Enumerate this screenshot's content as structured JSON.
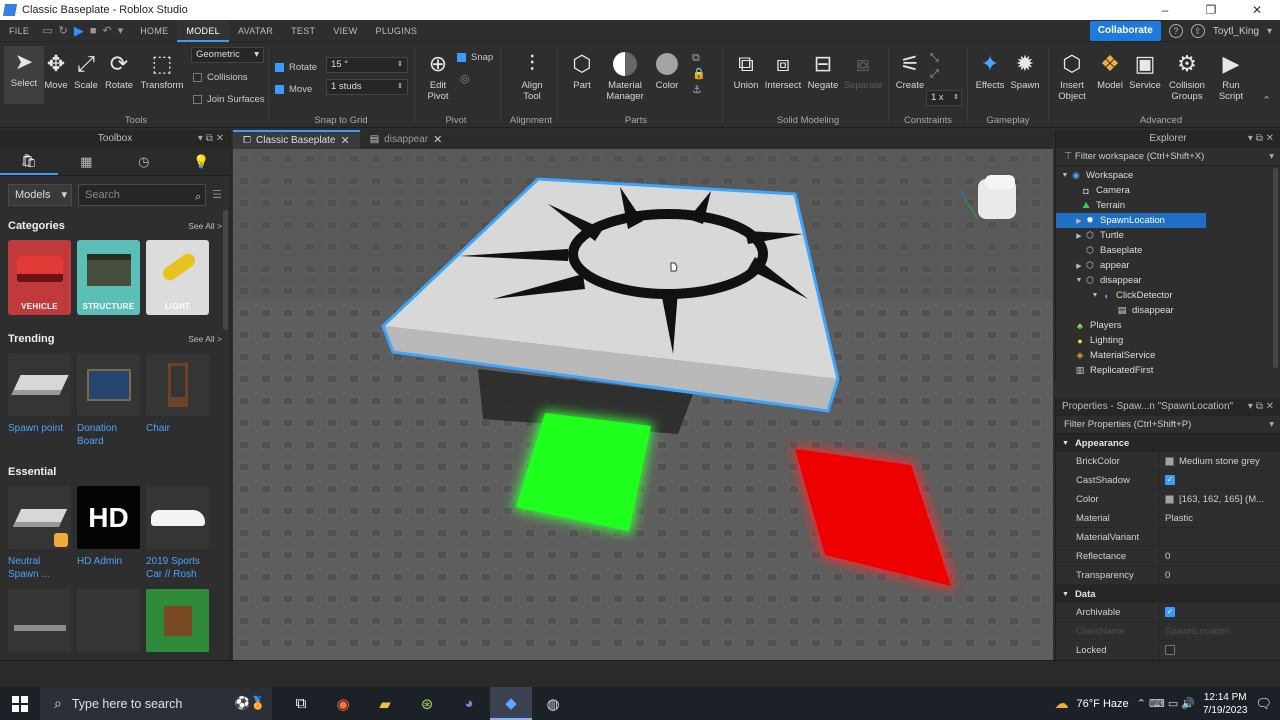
{
  "window": {
    "title": "Classic Baseplate - Roblox Studio"
  },
  "menu": {
    "file": "FILE",
    "tabs": [
      "HOME",
      "MODEL",
      "AVATAR",
      "TEST",
      "VIEW",
      "PLUGINS"
    ],
    "collaborate": "Collaborate",
    "user": "Toytl_King"
  },
  "ribbon": {
    "tools": {
      "select": "Select",
      "move": "Move",
      "scale": "Scale",
      "rotate": "Rotate",
      "transform": "Transform",
      "label": "Tools"
    },
    "mode_select": "Geometric",
    "collisions": "Collisions",
    "join_surfaces": "Join Surfaces",
    "snap": {
      "rotate_label": "Rotate",
      "rotate_value": "15 °",
      "move_label": "Move",
      "move_value": "1 studs",
      "label": "Snap to Grid"
    },
    "pivot": {
      "edit": "Edit Pivot",
      "snap": "Snap",
      "label": "Pivot"
    },
    "alignment": {
      "align": "Align Tool",
      "label": "Alignment"
    },
    "parts": {
      "part": "Part",
      "material": "Material Manager",
      "color": "Color",
      "label": "Parts"
    },
    "solid": {
      "union": "Union",
      "intersect": "Intersect",
      "negate": "Negate",
      "separate": "Separate",
      "label": "Solid Modeling"
    },
    "constraints": {
      "create": "Create",
      "scale": "1 x",
      "label": "Constraints"
    },
    "gameplay": {
      "effects": "Effects",
      "spawn": "Spawn",
      "label": "Gameplay"
    },
    "advanced": {
      "insert": "Insert Object",
      "model": "Model",
      "service": "Service",
      "collision": "Collision Groups",
      "run": "Run Script",
      "label": "Advanced"
    }
  },
  "toolbox": {
    "title": "Toolbox",
    "category_select": "Models",
    "search_placeholder": "Search",
    "categories_title": "Categories",
    "see_all": "See All >",
    "categories": [
      "VEHICLE",
      "STRUCTURE",
      "LIGHT"
    ],
    "trending_title": "Trending",
    "trending": [
      "Spawn point",
      "Donation Board",
      "Chair"
    ],
    "essential_title": "Essential",
    "essential": [
      "Neutral Spawn ...",
      "HD Admin",
      "2019 Sports Car // Rosh"
    ],
    "hd_logo": "HD"
  },
  "tabs": {
    "tab1": "Classic Baseplate",
    "tab2": "disappear"
  },
  "explorer": {
    "title": "Explorer",
    "filter": "Filter workspace (Ctrl+Shift+X)",
    "items": [
      "Workspace",
      "Camera",
      "Terrain",
      "SpawnLocation",
      "Turtle",
      "Baseplate",
      "appear",
      "disappear",
      "ClickDetector",
      "disappear",
      "Players",
      "Lighting",
      "MaterialService",
      "ReplicatedFirst"
    ]
  },
  "properties": {
    "title": "Properties - Spaw...n \"SpawnLocation\"",
    "filter": "Filter Properties (Ctrl+Shift+P)",
    "appearance": "Appearance",
    "data": "Data",
    "rows": [
      {
        "name": "BrickColor",
        "value": "Medium stone grey"
      },
      {
        "name": "CastShadow",
        "value": ""
      },
      {
        "name": "Color",
        "value": "[163, 162, 165] (M..."
      },
      {
        "name": "Material",
        "value": "Plastic"
      },
      {
        "name": "MaterialVariant",
        "value": ""
      },
      {
        "name": "Reflectance",
        "value": "0"
      },
      {
        "name": "Transparency",
        "value": "0"
      }
    ],
    "data_rows": [
      {
        "name": "Archivable",
        "value": ""
      },
      {
        "name": "ClassName",
        "value": "SpawnLocation"
      },
      {
        "name": "Locked",
        "value": ""
      }
    ]
  },
  "taskbar": {
    "search_placeholder": "Type here to search",
    "weather": "76°F  Haze",
    "time": "12:14 PM",
    "date": "7/19/2023"
  }
}
